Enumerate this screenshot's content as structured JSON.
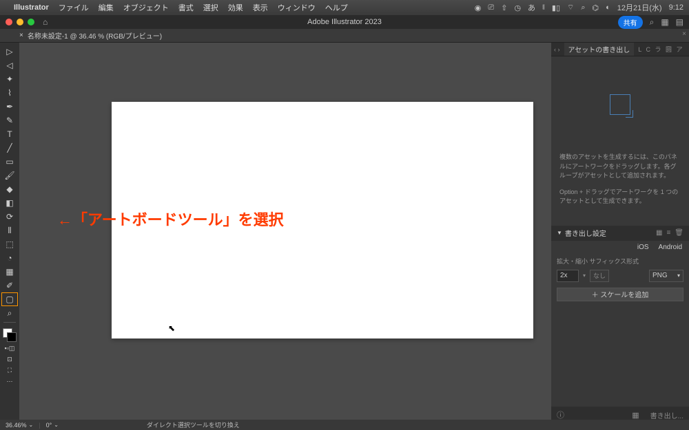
{
  "mac_menu": {
    "app_name": "Illustrator",
    "items": [
      "ファイル",
      "編集",
      "オブジェクト",
      "書式",
      "選択",
      "効果",
      "表示",
      "ウィンドウ",
      "ヘルプ"
    ],
    "date": "12月21日(水)",
    "time": "9:12"
  },
  "app": {
    "title": "Adobe Illustrator 2023",
    "share_label": "共有"
  },
  "doc_tab": {
    "label": "名称未設定-1 @ 36.46 % (RGB/プレビュー)"
  },
  "annotation": {
    "text": "←「アートボードツール」を選択"
  },
  "panel": {
    "tab_label": "アセットの書き出し",
    "tab_mini": "L C ラ 圆 ア",
    "hint1": "複数のアセットを生成するには、このパネルにアートワークをドラッグします。各グループがアセットとして追加されます。",
    "hint2": "Option + ドラッグでアートワークを 1 つのアセットとして生成できます。",
    "settings_label": "書き出し設定",
    "platform_ios": "iOS",
    "platform_android": "Android",
    "scale_label": "拡大・縮小  サフィックス形式",
    "scale_value": "2x",
    "scale_none": "なし",
    "format": "PNG",
    "add_scale": "＋ スケールを追加",
    "export_btn": "書き出し..."
  },
  "status": {
    "zoom": "36.46%",
    "rotation": "0°",
    "tool_hint": "ダイレクト選択ツールを切り換え"
  }
}
